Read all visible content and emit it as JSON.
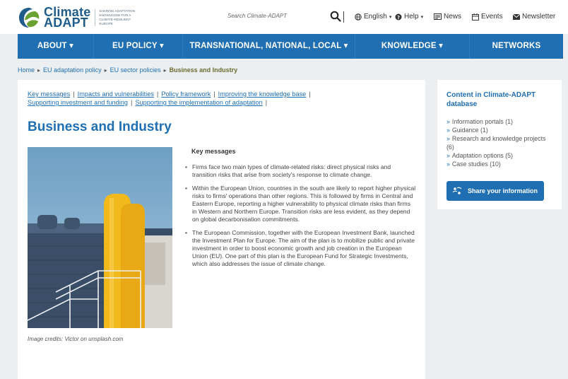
{
  "header": {
    "logo_line1": "Climate",
    "logo_line2": "ADAPT",
    "tagline": "Sharing adaptation knowledge for a climate-resilient Europe",
    "search_placeholder": "Search Climate-ADAPT",
    "language": "English",
    "help": "Help",
    "news": "News",
    "events": "Events",
    "newsletter": "Newsletter",
    "icons": [
      "search-icon",
      "globe-icon",
      "help-icon",
      "news-icon",
      "calendar-icon",
      "envelope-icon"
    ]
  },
  "nav": {
    "items": [
      {
        "label": "ABOUT ▾"
      },
      {
        "label": "EU POLICY ▾"
      },
      {
        "label": "TRANSNATIONAL, NATIONAL, LOCAL ▾"
      },
      {
        "label": "KNOWLEDGE ▾"
      },
      {
        "label": "NETWORKS"
      }
    ]
  },
  "breadcrumb": {
    "items": [
      "Home",
      "EU adaptation policy",
      "EU sector policies"
    ],
    "current": "Business and Industry",
    "separator": "▸"
  },
  "anchors": {
    "links": [
      "Key messages",
      "Impacts and vulnerabilities",
      "Policy framework",
      "Improving the knowledge base",
      "Supporting investment and funding",
      "Supporting the implementation of adaptation"
    ],
    "separator": "|"
  },
  "page": {
    "title": "Business and Industry",
    "image_caption": "Image credits: Victor on unsplash.com",
    "key_messages_title": "Key messages",
    "key_messages": [
      "Firms face two main types of climate-related risks: direct physical risks and transition risks that arise from society's response to climate change.",
      "Within the European Union, countries in the south are likely to report higher physical risks to firms' operations than other regions. This is followed by firms in Central and Eastern Europe, reporting a higher vulnerability to physical climate risks than firms in Western and Northern Europe. Transition risks are less evident, as they depend on global decarbonisation commitments.",
      "The European Commission, together with the European Investment Bank, launched the Investment Plan for Europe. The aim of the plan is to mobilize public and private investment in order to boost economic growth and job creation in the European Union (EU). One part of this plan is the European Fund for Strategic Investments, which also addresses the issue of climate change."
    ]
  },
  "sidebar": {
    "title": "Content in Climate-ADAPT database",
    "arrow": "»",
    "items": [
      {
        "label": "Information portals (1)"
      },
      {
        "label": "Guidance (1)"
      },
      {
        "label": "Research and knowledge projects (6)"
      },
      {
        "label": "Adaptation options (5)"
      },
      {
        "label": "Case studies (10)"
      }
    ],
    "share_button": "Share your information"
  },
  "colors": {
    "brand_blue": "#1f6fb2",
    "logo_green": "#6aa232",
    "breadcrumb_current": "#6b6b2f",
    "background": "#eceff1"
  }
}
